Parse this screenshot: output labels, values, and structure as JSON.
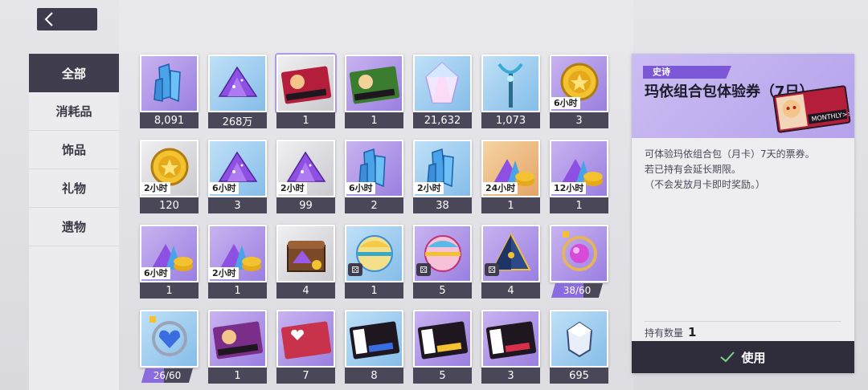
{
  "sidebar": {
    "items": [
      {
        "label": "全部",
        "active": true
      },
      {
        "label": "消耗品",
        "active": false
      },
      {
        "label": "饰品",
        "active": false
      },
      {
        "label": "礼物",
        "active": false
      },
      {
        "label": "遗物",
        "active": false
      }
    ]
  },
  "grid": {
    "items": [
      {
        "icon": "blue-crystal",
        "rarity": "epic",
        "count": "8,091"
      },
      {
        "icon": "purple-gem-pile",
        "rarity": "rare",
        "count": "268万"
      },
      {
        "icon": "monthly-ticket-red",
        "rarity": "common",
        "count": "1",
        "selected": true
      },
      {
        "icon": "monthly-ticket-green",
        "rarity": "epic",
        "count": "1"
      },
      {
        "icon": "rainbow-crystal",
        "rarity": "rare",
        "count": "21,632"
      },
      {
        "icon": "blue-trident",
        "rarity": "rare",
        "count": "1,073"
      },
      {
        "icon": "gold-coin",
        "rarity": "epic",
        "count": "3",
        "tag": "6小时"
      },
      {
        "icon": "gold-coin",
        "rarity": "common",
        "count": "120",
        "tag": "2小时"
      },
      {
        "icon": "purple-gem-pile",
        "rarity": "rare",
        "count": "3",
        "tag": "6小时"
      },
      {
        "icon": "purple-gem-pile",
        "rarity": "common",
        "count": "99",
        "tag": "2小时"
      },
      {
        "icon": "blue-crystal",
        "rarity": "epic",
        "count": "2",
        "tag": "6小时"
      },
      {
        "icon": "blue-crystal",
        "rarity": "rare",
        "count": "38",
        "tag": "2小时"
      },
      {
        "icon": "resource-bundle",
        "rarity": "legend",
        "count": "1",
        "tag": "24小时"
      },
      {
        "icon": "resource-bundle",
        "rarity": "epic",
        "count": "1",
        "tag": "12小时"
      },
      {
        "icon": "resource-bundle",
        "rarity": "epic",
        "count": "1",
        "tag": "6小时"
      },
      {
        "icon": "resource-bundle",
        "rarity": "epic",
        "count": "1",
        "tag": "2小时"
      },
      {
        "icon": "treasure-chest",
        "rarity": "common",
        "count": "4"
      },
      {
        "icon": "gacha-ball-yellow",
        "rarity": "rare",
        "count": "1",
        "dice": true
      },
      {
        "icon": "gacha-ball-pink",
        "rarity": "epic",
        "count": "5",
        "dice": true
      },
      {
        "icon": "pyramid-box",
        "rarity": "epic",
        "count": "4",
        "dice": true
      },
      {
        "icon": "pink-orb-accessory",
        "rarity": "epic",
        "progress": "38/60",
        "progress_value": 0.63
      },
      {
        "icon": "heart-shield-accessory",
        "rarity": "rare",
        "progress": "26/60",
        "progress_value": 0.43
      },
      {
        "icon": "alchemy-ticket",
        "rarity": "epic",
        "count": "1"
      },
      {
        "icon": "wishlist-ticket",
        "rarity": "epic",
        "count": "7"
      },
      {
        "icon": "soul-ticket-blue",
        "rarity": "rare",
        "count": "8"
      },
      {
        "icon": "soul-ticket-pick",
        "rarity": "epic",
        "count": "5"
      },
      {
        "icon": "soul-ticket-red",
        "rarity": "epic",
        "count": "3"
      },
      {
        "icon": "white-gem",
        "rarity": "rare",
        "count": "695"
      }
    ]
  },
  "detail": {
    "rarity_label": "史诗",
    "title": "玛依组合包体验券（7日）",
    "description": [
      "可体验玛依组合包（月卡）7天的票券。",
      "若已持有会延长期限。",
      "（不会发放月卡即时奖励。）"
    ],
    "qty_label": "持有数量",
    "qty_value": "1",
    "use_label": "使用"
  },
  "colors": {
    "epic": "#9a7fe0",
    "rare": "#85bde8",
    "common": "#c9c9cf",
    "legend": "#e4a566",
    "dark": "#3f3d4e",
    "accent": "#7c57d6"
  }
}
